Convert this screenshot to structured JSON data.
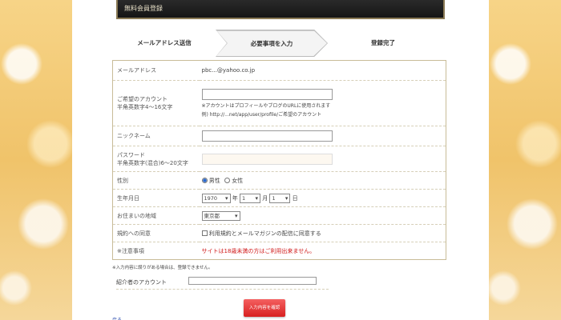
{
  "header": {
    "title": "無料会員登録"
  },
  "steps": [
    {
      "label": "メールアドレス送信"
    },
    {
      "label": "必要事項を入力"
    },
    {
      "label": "登録完了"
    }
  ],
  "form": {
    "email": {
      "label": "メールアドレス",
      "value": "pbc...@yahoo.co.jp"
    },
    "account": {
      "label_1": "ご希望のアカウント",
      "label_2": "半角英数字4〜16文字",
      "note_1": "※アカウントはプロフィールやブログのURLに使用されます",
      "note_2": "例) http://...net/app/user/profile/ご希望のアカウント"
    },
    "nickname": {
      "label": "ニックネーム"
    },
    "password": {
      "label_1": "パスワード",
      "label_2": "半角英数字(混合)6〜20文字"
    },
    "sex": {
      "label": "性別",
      "option_male": "男性",
      "option_female": "女性"
    },
    "birth": {
      "label": "生年月日",
      "year_value": "1970",
      "year_unit": "年",
      "month_value": "1",
      "month_unit": "月",
      "day_value": "1",
      "day_unit": "日"
    },
    "area": {
      "label": "お住まいの地域",
      "value": "東京都"
    },
    "terms": {
      "label": "規約への同意",
      "text": "利用規約とメールマガジンの配信に同意する"
    },
    "notice": {
      "label": "※注意事項",
      "text": "サイトは18歳未満の方はご利用出来ません。"
    }
  },
  "note_line": "※入力内容に誤りがある場合は、登録できません。",
  "referrer": {
    "label": "紹介者のアカウント"
  },
  "submit_button": "入力内容を確認",
  "back_link": "戻る",
  "colors": {
    "accent_red": "#d01818",
    "button_red": "#e03030",
    "border": "#c8bc98"
  }
}
